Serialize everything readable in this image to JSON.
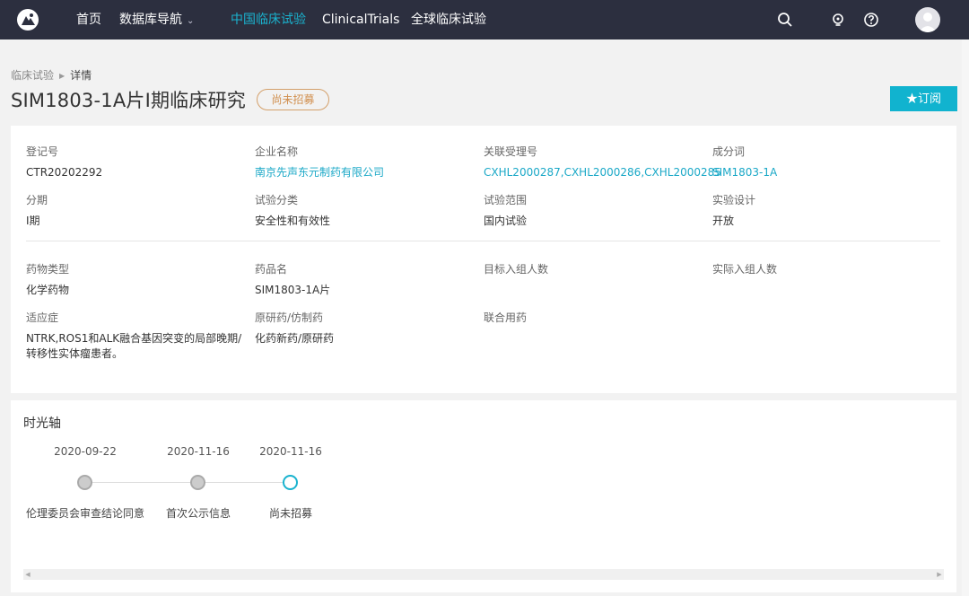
{
  "nav": {
    "home": "首页",
    "db_nav": "数据库导航",
    "china_trials": "中国临床试验",
    "clinical_trials": "ClinicalTrials",
    "global_trials": "全球临床试验",
    "active": "china_trials"
  },
  "breadcrumb": {
    "parent": "临床试验",
    "current": "详情"
  },
  "page": {
    "title": "SIM1803-1A片I期临床研究",
    "status": "尚未招募",
    "subscribe": "★订阅"
  },
  "fields": {
    "reg_no": {
      "label": "登记号",
      "value": "CTR20202292"
    },
    "company": {
      "label": "企业名称",
      "value": "南京先声东元制药有限公司"
    },
    "acceptance": {
      "label": "关联受理号",
      "value": "CXHL2000287,CXHL2000286,CXHL2000285"
    },
    "component": {
      "label": "成分词",
      "value": "SIM1803-1A"
    },
    "phase": {
      "label": "分期",
      "value": "I期"
    },
    "category": {
      "label": "试验分类",
      "value": "安全性和有效性"
    },
    "scope": {
      "label": "试验范围",
      "value": "国内试验"
    },
    "design": {
      "label": "实验设计",
      "value": "开放"
    },
    "drug_type": {
      "label": "药物类型",
      "value": "化学药物"
    },
    "drug_name": {
      "label": "药品名",
      "value": "SIM1803-1A片"
    },
    "target_enroll": {
      "label": "目标入组人数",
      "value": ""
    },
    "actual_enroll": {
      "label": "实际入组人数",
      "value": ""
    },
    "indication": {
      "label": "适应症",
      "value": "NTRK,ROS1和ALK融合基因突变的局部晚期/转移性实体瘤患者。"
    },
    "origin": {
      "label": "原研药/仿制药",
      "value": "化药新药/原研药"
    },
    "combo": {
      "label": "联合用药",
      "value": ""
    }
  },
  "timeline": {
    "title": "时光轴",
    "events": [
      {
        "date": "2020-09-22",
        "label": "伦理委员会审查结论同意",
        "current": false
      },
      {
        "date": "2020-11-16",
        "label": "首次公示信息",
        "current": false
      },
      {
        "date": "2020-11-16",
        "label": "尚未招募",
        "current": true
      }
    ]
  },
  "colors": {
    "topbar": "#2c2f3f",
    "accent": "#1ab3cf",
    "status": "#d19050"
  },
  "icons": [
    "logo-icon",
    "search-icon",
    "lightbulb-icon",
    "help-icon",
    "avatar-icon",
    "chevron-down-icon"
  ]
}
